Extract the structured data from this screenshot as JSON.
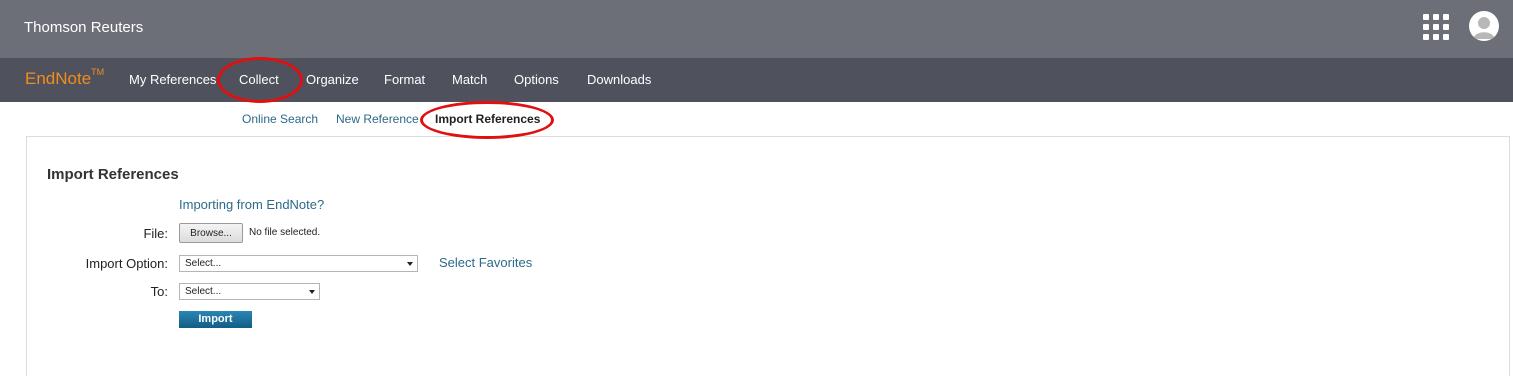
{
  "header": {
    "brand": "Thomson Reuters",
    "apps_icon": "apps-grid-icon",
    "avatar_icon": "user-avatar-icon"
  },
  "app": {
    "logo": "EndNote",
    "logo_tm": "TM",
    "logo_color": "#f28c1e"
  },
  "nav": {
    "items": [
      {
        "label": "My References"
      },
      {
        "label": "Collect"
      },
      {
        "label": "Organize"
      },
      {
        "label": "Format"
      },
      {
        "label": "Match"
      },
      {
        "label": "Options"
      },
      {
        "label": "Downloads"
      }
    ]
  },
  "subnav": {
    "items": [
      {
        "label": "Online Search"
      },
      {
        "label": "New Reference"
      },
      {
        "label": "Import References"
      }
    ],
    "active": "Import References"
  },
  "form": {
    "title": "Import References",
    "help_link": "Importing from EndNote?",
    "file_label": "File:",
    "browse_label": "Browse...",
    "no_file_text": "No file selected.",
    "import_option_label": "Import Option:",
    "import_option_value": "Select...",
    "favorites_link": "Select Favorites",
    "to_label": "To:",
    "to_value": "Select...",
    "import_button": "Import"
  },
  "annotation_color": "#e01010"
}
